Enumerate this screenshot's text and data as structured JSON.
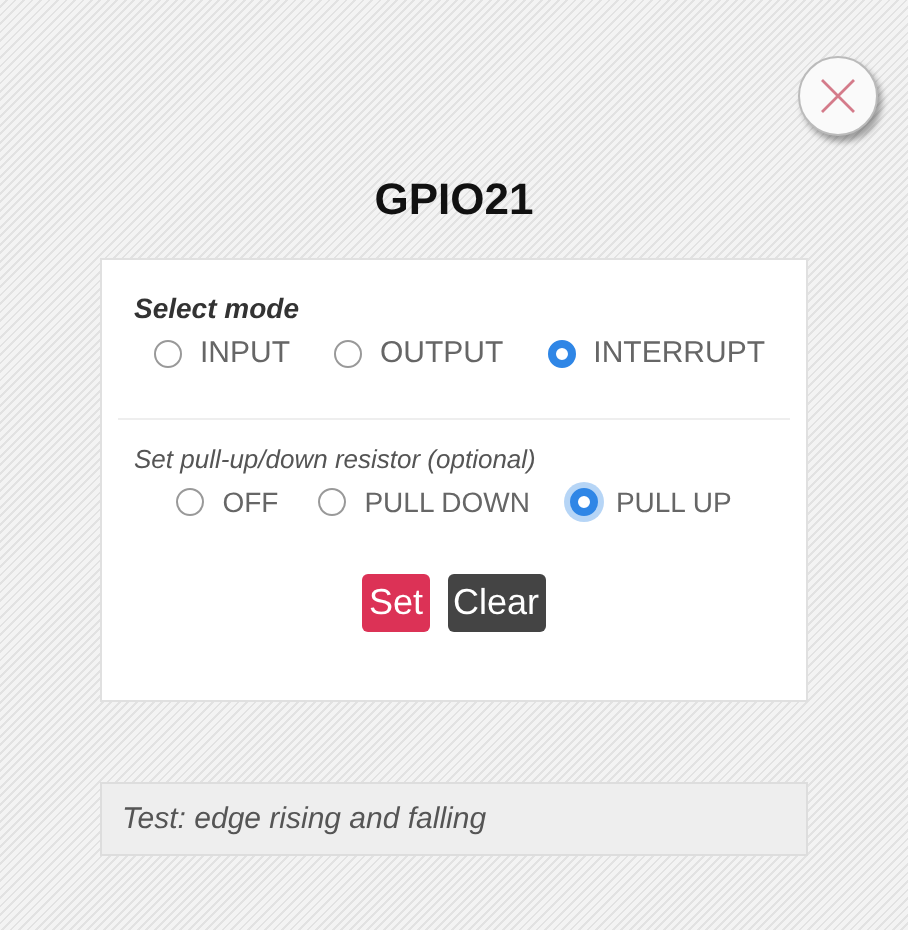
{
  "title": "GPIO21",
  "mode": {
    "label": "Select mode",
    "options": [
      {
        "label": "INPUT",
        "selected": false
      },
      {
        "label": "OUTPUT",
        "selected": false
      },
      {
        "label": "INTERRUPT",
        "selected": true
      }
    ]
  },
  "resistor": {
    "label": "Set pull-up/down resistor (optional)",
    "options": [
      {
        "label": "OFF",
        "selected": false
      },
      {
        "label": "PULL DOWN",
        "selected": false
      },
      {
        "label": "PULL UP",
        "selected": true,
        "focused": true
      }
    ]
  },
  "buttons": [
    {
      "label": "Set",
      "kind": "primary"
    },
    {
      "label": "Clear",
      "kind": "secondary"
    }
  ],
  "note": "Test: edge rising and falling"
}
